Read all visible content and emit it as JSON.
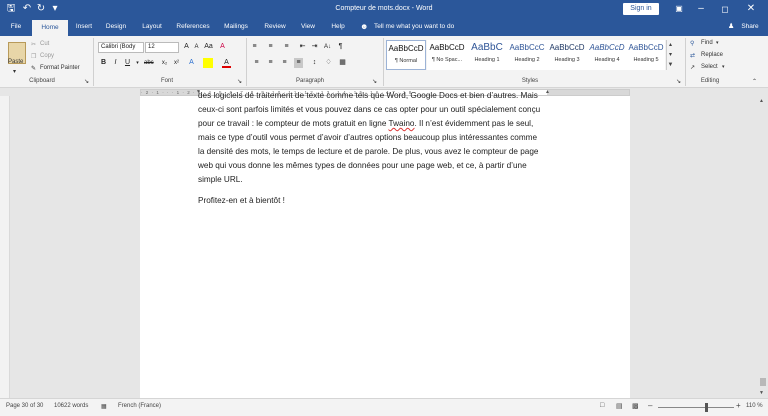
{
  "title": "Compteur de mots.docx - Word",
  "signin": "Sign in",
  "share": "Share",
  "tell_me": "Tell me what you want to do",
  "tabs": [
    "File",
    "Home",
    "Insert",
    "Design",
    "Layout",
    "References",
    "Mailings",
    "Review",
    "View",
    "Help"
  ],
  "clipboard": {
    "paste": "Paste",
    "cut": "Cut",
    "copy": "Copy",
    "format_painter": "Format Painter",
    "label": "Clipboard"
  },
  "font": {
    "name": "Calibri (Body",
    "size": "12",
    "label": "Font"
  },
  "paragraph_label": "Paragraph",
  "styles": {
    "label": "Styles",
    "items": [
      {
        "preview": "AaBbCcD",
        "name": "¶ Normal"
      },
      {
        "preview": "AaBbCcD",
        "name": "¶ No Spac..."
      },
      {
        "preview": "AaBbC",
        "name": "Heading 1"
      },
      {
        "preview": "AaBbCcC",
        "name": "Heading 2"
      },
      {
        "preview": "AaBbCcD",
        "name": "Heading 3"
      },
      {
        "preview": "AaBbCcD",
        "name": "Heading 4"
      },
      {
        "preview": "AaBbCcD",
        "name": "Heading 5"
      }
    ]
  },
  "editing": {
    "find": "Find",
    "replace": "Replace",
    "select": "Select",
    "label": "Editing"
  },
  "document": {
    "para1_line0": "des logiciels de traitement de texte comme tels que Word, Google Docs et bien d’autres. Mais",
    "para1_line1": "ceux-ci sont parfois limités et vous pouvez dans ce cas opter pour un outil spécialement conçu",
    "para1_line2a": "pour ce travail : le compteur de mots gratuit en ligne ",
    "para1_link": "Twaino",
    "para1_line2b": ". Il n’est évidemment pas le seul,",
    "para1_line3": "mais ce type d’outil vous permet d’avoir d’autres options beaucoup plus intéressantes comme",
    "para1_line4": "la densité des mots, le temps de lecture et de parole. De plus, vous avez le compteur de page",
    "para1_line5": "web qui vous donne les mêmes types de données pour une page web, et ce, à partir d’une",
    "para1_line6": "simple URL.",
    "para2": "Profitez-en et à bientôt !"
  },
  "status": {
    "page": "Page 30 of 30",
    "words": "10622 words",
    "language": "French (France)",
    "zoom": "110 %"
  }
}
